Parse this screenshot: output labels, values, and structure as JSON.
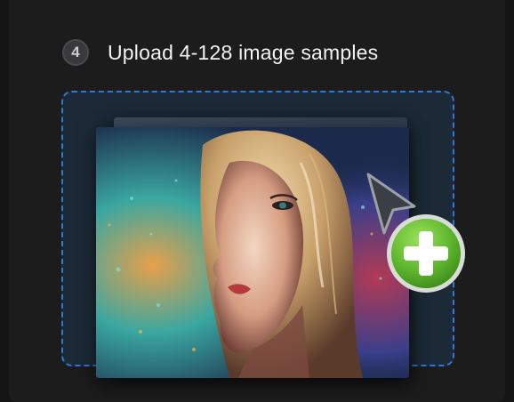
{
  "step": {
    "number": "4",
    "title": "Upload 4-128 image samples"
  },
  "dropzone": {
    "border_color": "#2f78d6",
    "background": "#1c2a37"
  },
  "icons": {
    "cursor": "arrow-cursor-icon",
    "add": "plus-circle-icon"
  },
  "colors": {
    "add_green": "#6cc43a",
    "panel": "#1c1c1d"
  }
}
